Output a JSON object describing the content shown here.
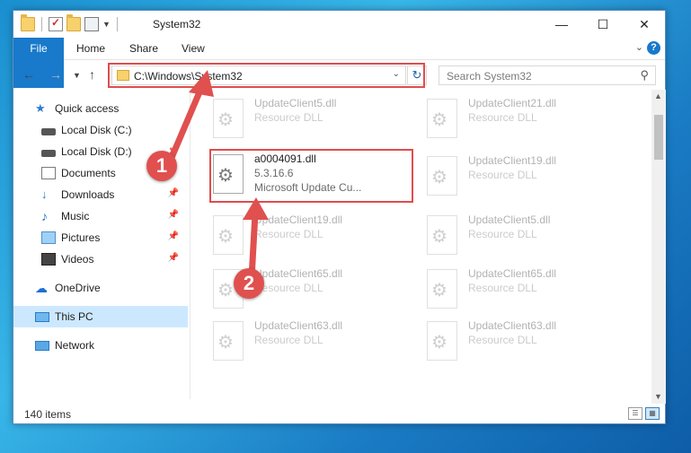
{
  "title_bar": {
    "title": "System32"
  },
  "window_controls": {
    "minimize": "—",
    "maximize": "☐",
    "close": "✕"
  },
  "ribbon": {
    "tabs": [
      {
        "label": "File"
      },
      {
        "label": "Home"
      },
      {
        "label": "Share"
      },
      {
        "label": "View"
      }
    ]
  },
  "address_bar": {
    "path": "C:\\Windows\\System32"
  },
  "search": {
    "placeholder": "Search System32"
  },
  "nav_pane": {
    "items": [
      {
        "label": "Quick access",
        "icon": "star-icon"
      },
      {
        "label": "Local Disk (C:)",
        "icon": "drive-icon"
      },
      {
        "label": "Local Disk (D:)",
        "icon": "drive-icon"
      },
      {
        "label": "Documents",
        "icon": "documents-icon"
      },
      {
        "label": "Downloads",
        "icon": "downloads-icon"
      },
      {
        "label": "Music",
        "icon": "music-icon"
      },
      {
        "label": "Pictures",
        "icon": "pictures-icon"
      },
      {
        "label": "Videos",
        "icon": "videos-icon"
      },
      {
        "label": "OneDrive",
        "icon": "cloud-icon"
      },
      {
        "label": "This PC",
        "icon": "computer-icon",
        "selected": true
      },
      {
        "label": "Network",
        "icon": "network-icon"
      }
    ]
  },
  "files": {
    "left": [
      {
        "name": "UpdateClient5.dll",
        "type": "Resource DLL"
      },
      {
        "name": "a0004091.dll",
        "version": "5.3.16.6",
        "company": "Microsoft Update Cu..."
      },
      {
        "name": "UpdateClient19.dll",
        "type": "Resource DLL"
      },
      {
        "name": "UpdateClient65.dll",
        "type": "Resource DLL"
      },
      {
        "name": "UpdateClient63.dll",
        "type": "Resource DLL"
      }
    ],
    "right": [
      {
        "name": "UpdateClient21.dll",
        "type": "Resource DLL"
      },
      {
        "name": "UpdateClient19.dll",
        "type": "Resource DLL"
      },
      {
        "name": "UpdateClient5.dll",
        "type": "Resource DLL"
      },
      {
        "name": "UpdateClient65.dll",
        "type": "Resource DLL"
      },
      {
        "name": "UpdateClient63.dll",
        "type": "Resource DLL"
      }
    ]
  },
  "status_bar": {
    "item_count": "140 items"
  },
  "annotations": {
    "marker1": "1",
    "marker2": "2"
  },
  "colors": {
    "accent": "#1979ca",
    "highlight": "#e04c4c",
    "selected": "#cce8ff"
  }
}
